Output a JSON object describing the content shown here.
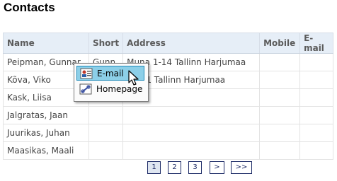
{
  "title": "Contacts",
  "table": {
    "columns": [
      "Name",
      "Short",
      "Address",
      "Mobile",
      "E-mail"
    ],
    "rows": [
      {
        "name": "Peipman, Gunnar",
        "short": "Gunn",
        "address": "Muna 1-14 Tallinn Harjumaa",
        "mobile": "",
        "email": ""
      },
      {
        "name": "Kõva, Viko",
        "short": "",
        "address": "10-21 Tallinn Harjumaa",
        "mobile": "",
        "email": ""
      },
      {
        "name": "Kask, Liisa",
        "short": "",
        "address": "",
        "mobile": "",
        "email": ""
      },
      {
        "name": "Jalgratas, Jaan",
        "short": "",
        "address": "",
        "mobile": "",
        "email": ""
      },
      {
        "name": "Juurikas, Juhan",
        "short": "",
        "address": "",
        "mobile": "",
        "email": ""
      },
      {
        "name": "Maasikas, Maali",
        "short": "",
        "address": "",
        "mobile": "",
        "email": ""
      }
    ]
  },
  "context_menu": {
    "items": [
      {
        "label": "E-mail",
        "icon": "email-contact-icon",
        "active": true
      },
      {
        "label": "Homepage",
        "icon": "link-icon",
        "active": false
      }
    ]
  },
  "pager": {
    "pages": [
      "1",
      "2",
      "3"
    ],
    "current": "1",
    "next_label": ">",
    "last_label": ">>"
  }
}
